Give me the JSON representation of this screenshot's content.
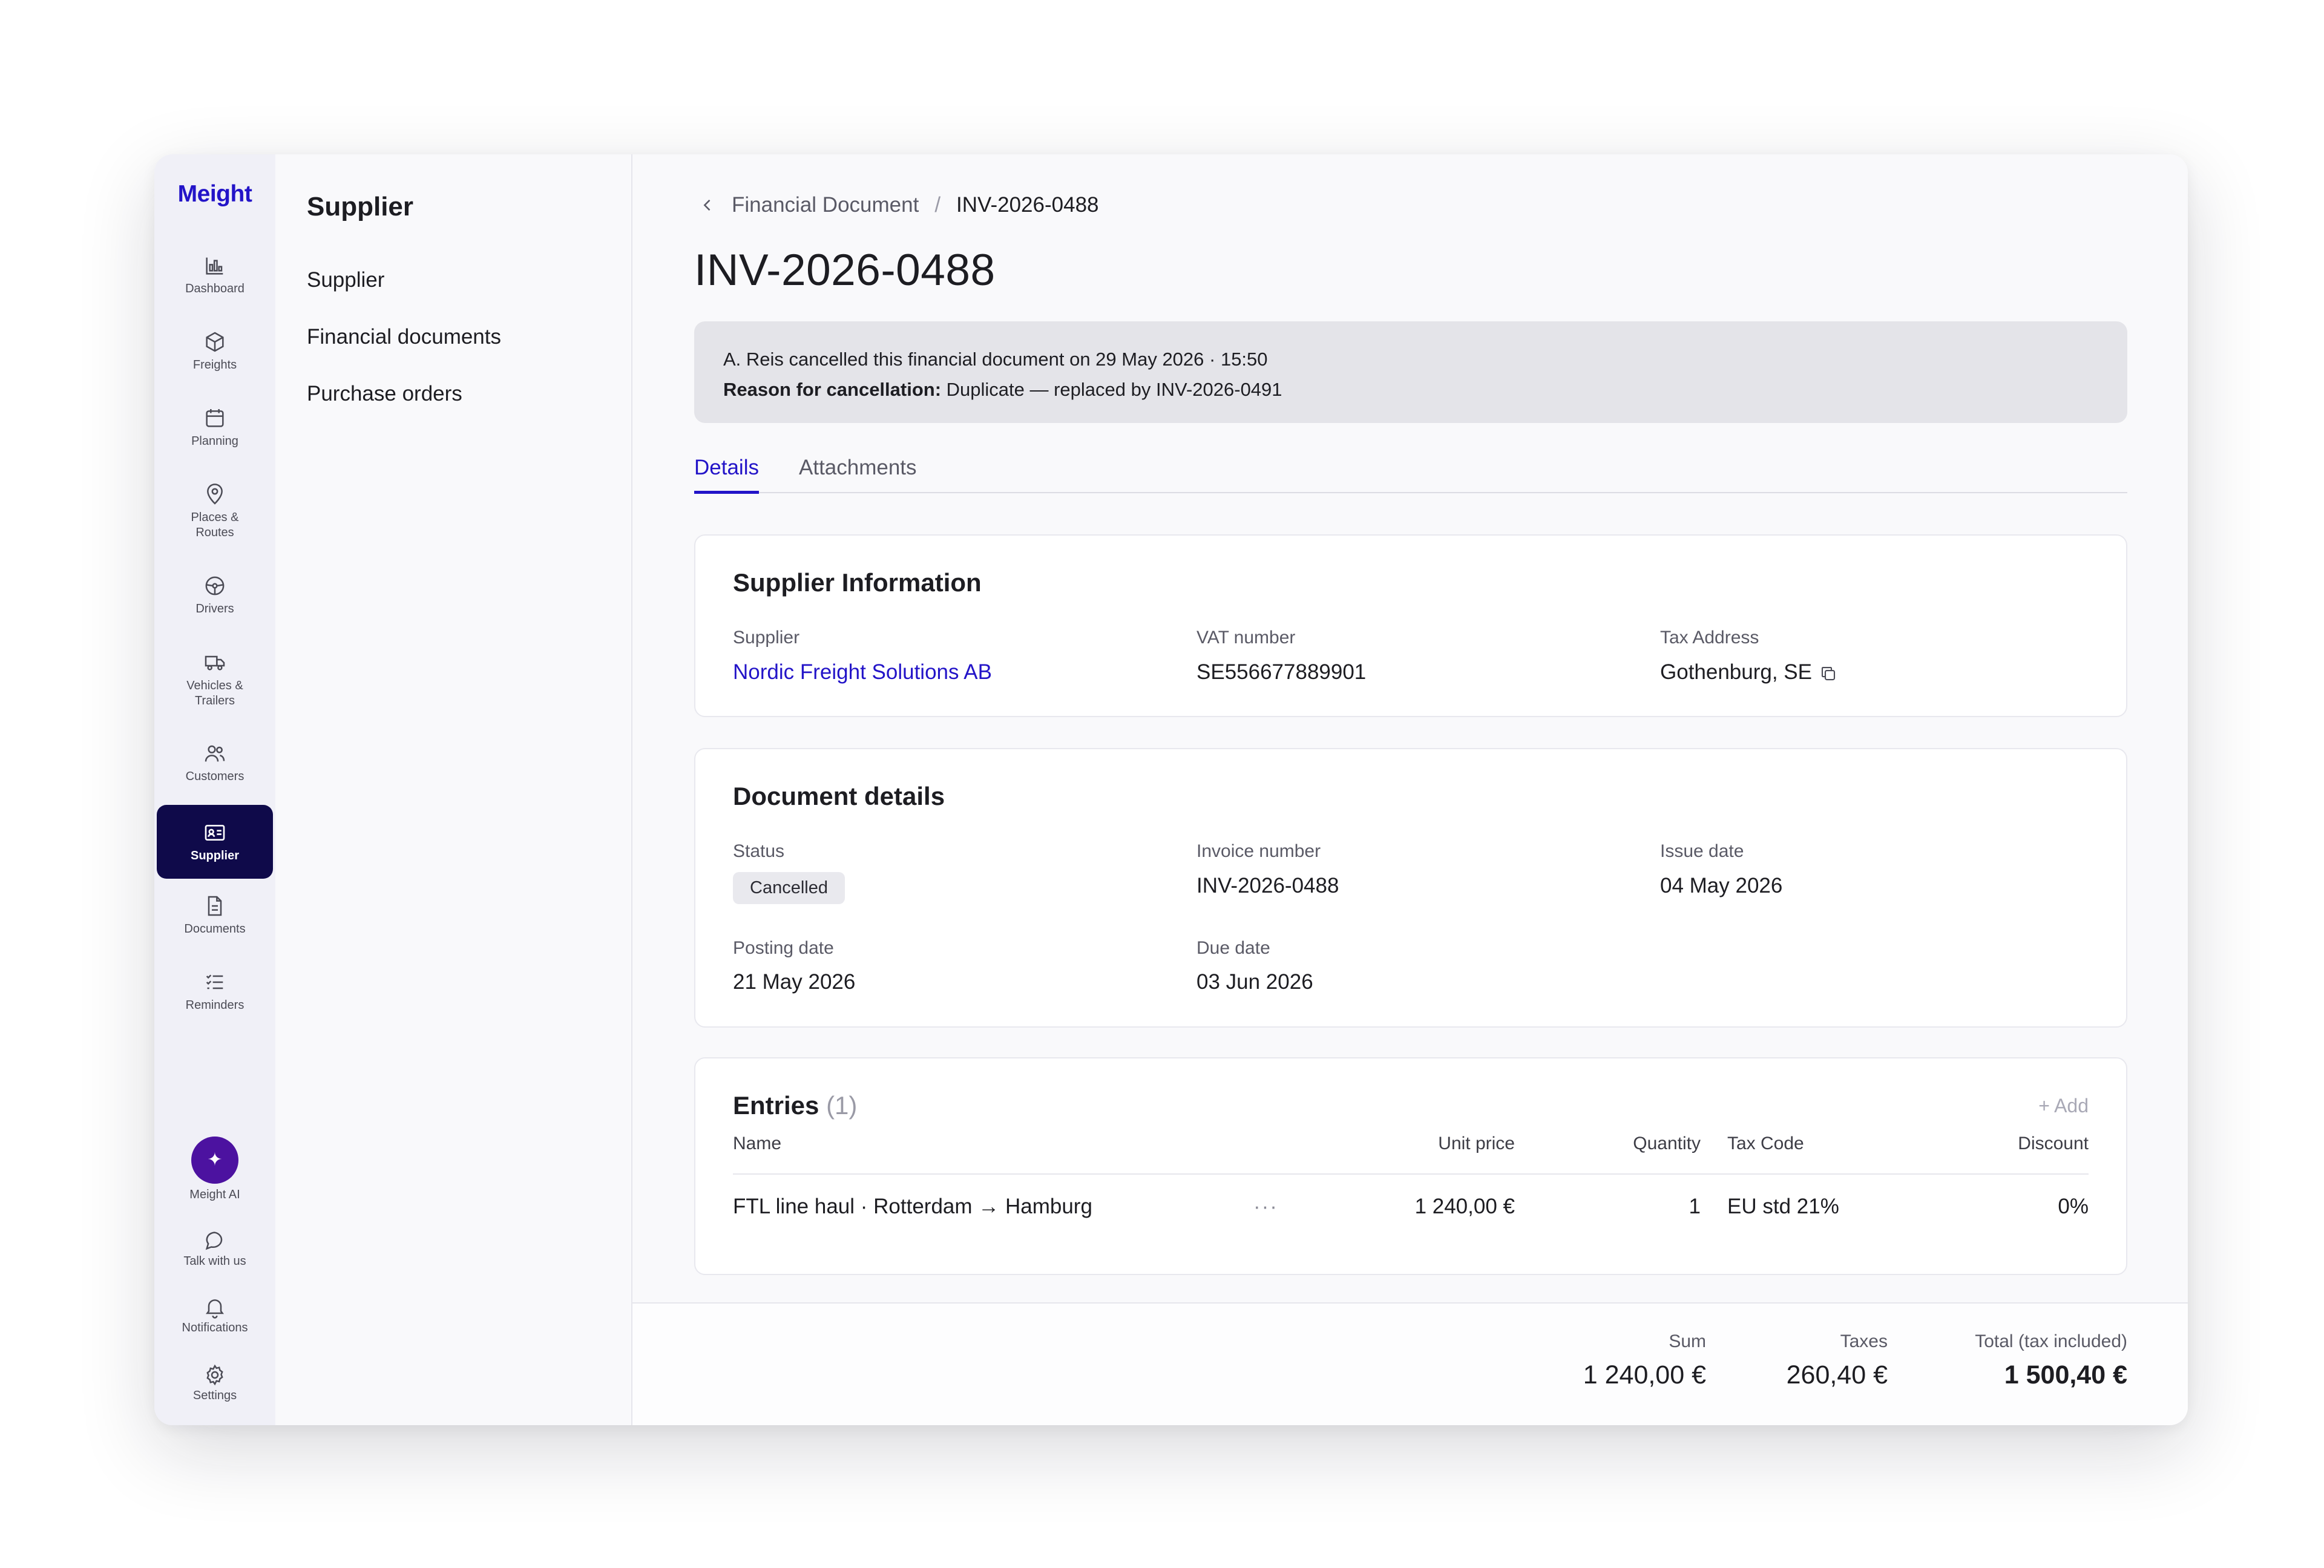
{
  "app": {
    "logo": "Meight"
  },
  "rail": {
    "items": [
      {
        "label": "Dashboard",
        "icon": "bar-chart-icon"
      },
      {
        "label": "Freights",
        "icon": "box-icon"
      },
      {
        "label": "Planning",
        "icon": "calendar-icon"
      },
      {
        "label": "Places &",
        "label2": "Routes",
        "icon": "map-pin-icon"
      },
      {
        "label": "Drivers",
        "icon": "steering-wheel-icon"
      },
      {
        "label": "Vehicles &",
        "label2": "Trailers",
        "icon": "truck-icon"
      },
      {
        "label": "Customers",
        "icon": "users-icon"
      },
      {
        "label": "Supplier",
        "icon": "id-card-icon"
      },
      {
        "label": "Documents",
        "icon": "document-icon"
      },
      {
        "label": "Reminders",
        "icon": "checklist-icon"
      }
    ],
    "bottom": {
      "ai": "Meight AI",
      "talk": "Talk with us",
      "notifications": "Notifications",
      "settings": "Settings"
    }
  },
  "subnav": {
    "title": "Supplier",
    "items": [
      "Supplier",
      "Financial documents",
      "Purchase orders"
    ]
  },
  "breadcrumb": {
    "parent": "Financial Document",
    "separator": "/",
    "current": "INV-2026-0488"
  },
  "page_title": "INV-2026-0488",
  "banner": {
    "line1": "A. Reis cancelled this financial document on 29 May 2026 · 15:50",
    "reason_label": "Reason for cancellation:",
    "reason_text": " Duplicate — replaced by INV-2026-0491"
  },
  "tabs": [
    "Details",
    "Attachments"
  ],
  "supplier_info": {
    "title": "Supplier Information",
    "supplier_label": "Supplier",
    "supplier_value": "Nordic Freight Solutions AB",
    "vat_label": "VAT number",
    "vat_value": "SE556677889901",
    "tax_address_label": "Tax Address",
    "tax_address_value": "Gothenburg, SE"
  },
  "document_details": {
    "title": "Document details",
    "status_label": "Status",
    "status_value": "Cancelled",
    "invoice_label": "Invoice number",
    "invoice_value": "INV-2026-0488",
    "issue_label": "Issue date",
    "issue_value": "04 May 2026",
    "posting_label": "Posting date",
    "posting_value": "21 May 2026",
    "due_label": "Due date",
    "due_value": "03 Jun 2026"
  },
  "entries": {
    "title": "Entries",
    "count": "(1)",
    "add": "+ Add",
    "columns": {
      "name": "Name",
      "unit_price": "Unit price",
      "quantity": "Quantity",
      "tax_code": "Tax Code",
      "discount": "Discount"
    },
    "rows": [
      {
        "name": "FTL line haul · Rotterdam → Hamburg",
        "menu": "···",
        "unit_price": "1 240,00 €",
        "quantity": "1",
        "tax_code": "EU std 21%",
        "discount": "0%"
      }
    ]
  },
  "totals": {
    "sum_label": "Sum",
    "sum_value": "1 240,00 €",
    "taxes_label": "Taxes",
    "taxes_value": "260,40 €",
    "total_label": "Total (tax included)",
    "total_value": "1 500,40 €"
  },
  "colors": {
    "accent": "#2314c8",
    "rail_active": "#0f0a4a",
    "ai_button": "#4c12a0"
  }
}
